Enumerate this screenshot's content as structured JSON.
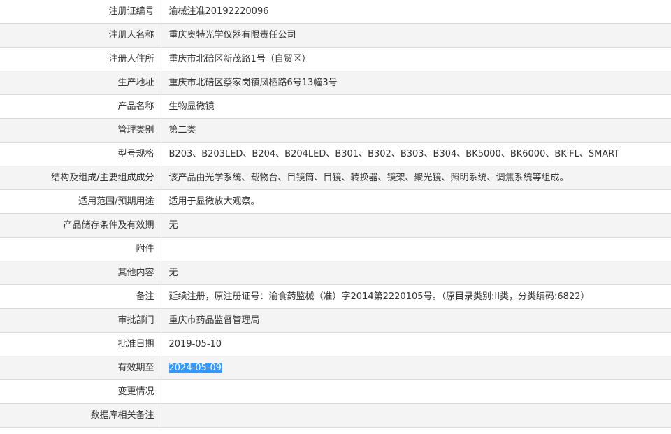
{
  "rows": [
    {
      "label": "注册证编号",
      "value": "渝械注准20192220096"
    },
    {
      "label": "注册人名称",
      "value": "重庆奥特光学仪器有限责任公司"
    },
    {
      "label": "注册人住所",
      "value": "重庆市北碚区新茂路1号（自贸区）"
    },
    {
      "label": "生产地址",
      "value": "重庆市北碚区蔡家岗镇凤栖路6号13幢3号"
    },
    {
      "label": "产品名称",
      "value": "生物显微镜"
    },
    {
      "label": "管理类别",
      "value": "第二类"
    },
    {
      "label": "型号规格",
      "value": "B203、B203LED、B204、B204LED、B301、B302、B303、B304、BK5000、BK6000、BK-FL、SMART"
    },
    {
      "label": "结构及组成/主要组成成分",
      "value": "该产品由光学系统、载物台、目镜筒、目镜、转换器、镜架、聚光镜、照明系统、调焦系统等组成。"
    },
    {
      "label": "适用范围/预期用途",
      "value": "适用于显微放大观察。"
    },
    {
      "label": "产品储存条件及有效期",
      "value": "无"
    },
    {
      "label": "附件",
      "value": ""
    },
    {
      "label": "其他内容",
      "value": "无"
    },
    {
      "label": "备注",
      "value": "延续注册，原注册证号：渝食药监械（准）字2014第2220105号。（原目录类别:II类，分类编码:6822）"
    },
    {
      "label": "审批部门",
      "value": "重庆市药品监督管理局"
    },
    {
      "label": "批准日期",
      "value": "2019-05-10"
    },
    {
      "label": "有效期至",
      "value": "2024-05-09"
    },
    {
      "label": "变更情况",
      "value": ""
    },
    {
      "label": "数据库相关备注",
      "value": ""
    }
  ],
  "colors": {
    "selection": "#3399ff",
    "row_alt": "#f4f4f4",
    "border": "#d9d9d9"
  }
}
